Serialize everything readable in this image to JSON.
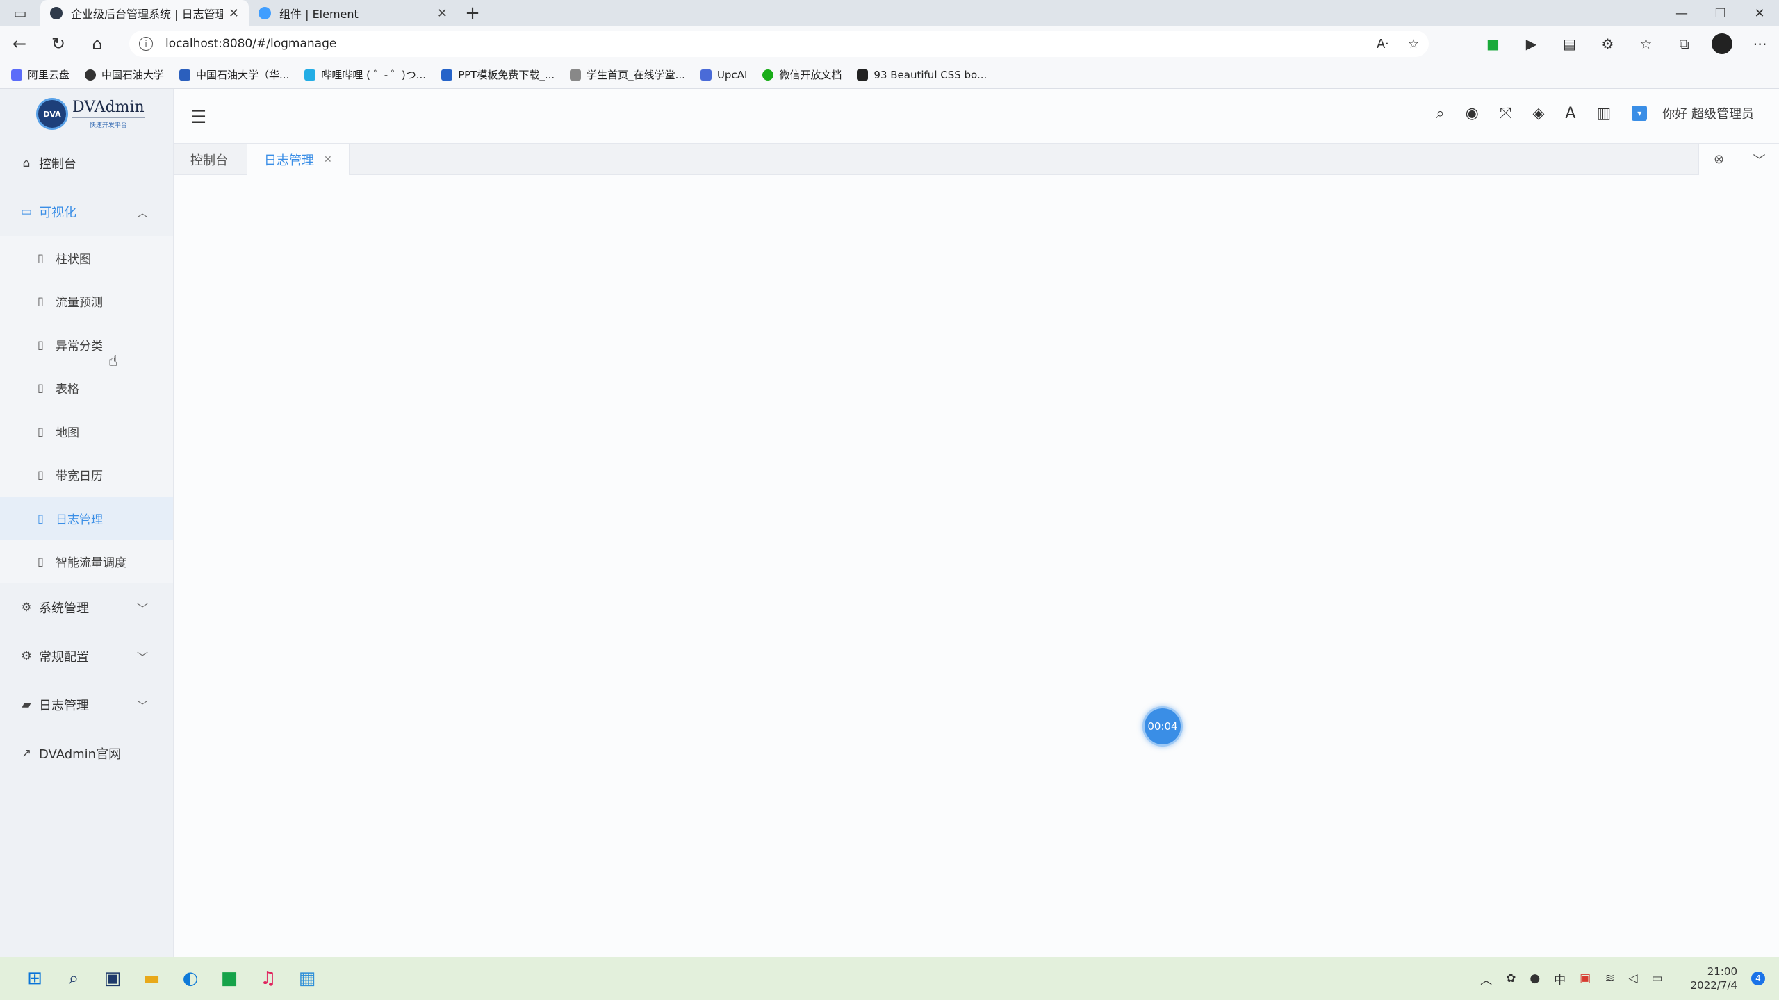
{
  "browser": {
    "tabs": [
      {
        "title": "企业级后台管理系统 | 日志管理",
        "active": true,
        "favicon_color": "#2f3a4a"
      },
      {
        "title": "组件 | Element",
        "active": false,
        "favicon_color": "#409eff"
      }
    ],
    "url": "localhost:8080/#/logmanage",
    "bookmarks": [
      {
        "label": "阿里云盘",
        "color": "#5b6cf9"
      },
      {
        "label": "中国石油大学",
        "color": "#333333"
      },
      {
        "label": "中国石油大学（华...",
        "color": "#2b5fbd"
      },
      {
        "label": "哔哩哔哩 ( ゜- ゜)つ...",
        "color": "#23ade5"
      },
      {
        "label": "PPT模板免费下载_...",
        "color": "#2563c9"
      },
      {
        "label": "学生首页_在线学堂...",
        "color": "#888888"
      },
      {
        "label": "UpcAI",
        "color": "#4a6bd8"
      },
      {
        "label": "微信开放文档",
        "color": "#1aad19"
      },
      {
        "label": "93 Beautiful CSS bo...",
        "color": "#222222"
      }
    ]
  },
  "app": {
    "logo": {
      "name": "DVAdmin",
      "mark": "DVA",
      "sub": "快速开发平台"
    },
    "sidebar": {
      "dashboard": "控制台",
      "visual": {
        "label": "可视化",
        "items": [
          "柱状图",
          "流量预测",
          "异常分类",
          "表格",
          "地图",
          "带宽日历",
          "日志管理",
          "智能流量调度"
        ],
        "active_index": 6
      },
      "system": "系统管理",
      "config": "常规配置",
      "logs": "日志管理",
      "site": "DVAdmin官网"
    },
    "header": {
      "greeting": "你好 超级管理员"
    },
    "tags": [
      {
        "label": "控制台",
        "active": false
      },
      {
        "label": "日志管理",
        "active": true
      }
    ],
    "timer": "00:04"
  },
  "taskbar": {
    "time": "21:00",
    "date": "2022/7/4",
    "notifications": "4"
  }
}
